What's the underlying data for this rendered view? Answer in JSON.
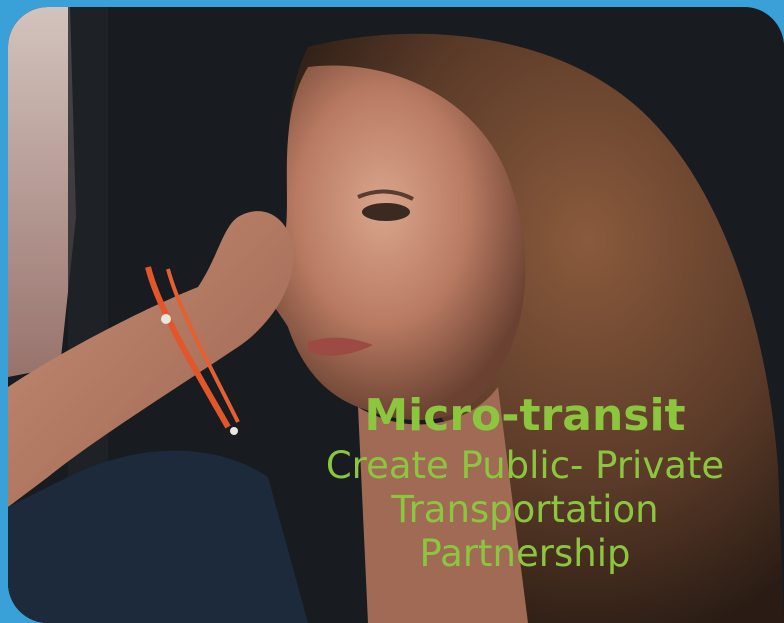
{
  "caption": {
    "title": "Micro-transit",
    "line1": "Create Public- Private",
    "line2": "Transportation",
    "line3": "Partnership"
  },
  "colors": {
    "frame": "#3aa0d8",
    "caption_text": "#8cc63f"
  }
}
